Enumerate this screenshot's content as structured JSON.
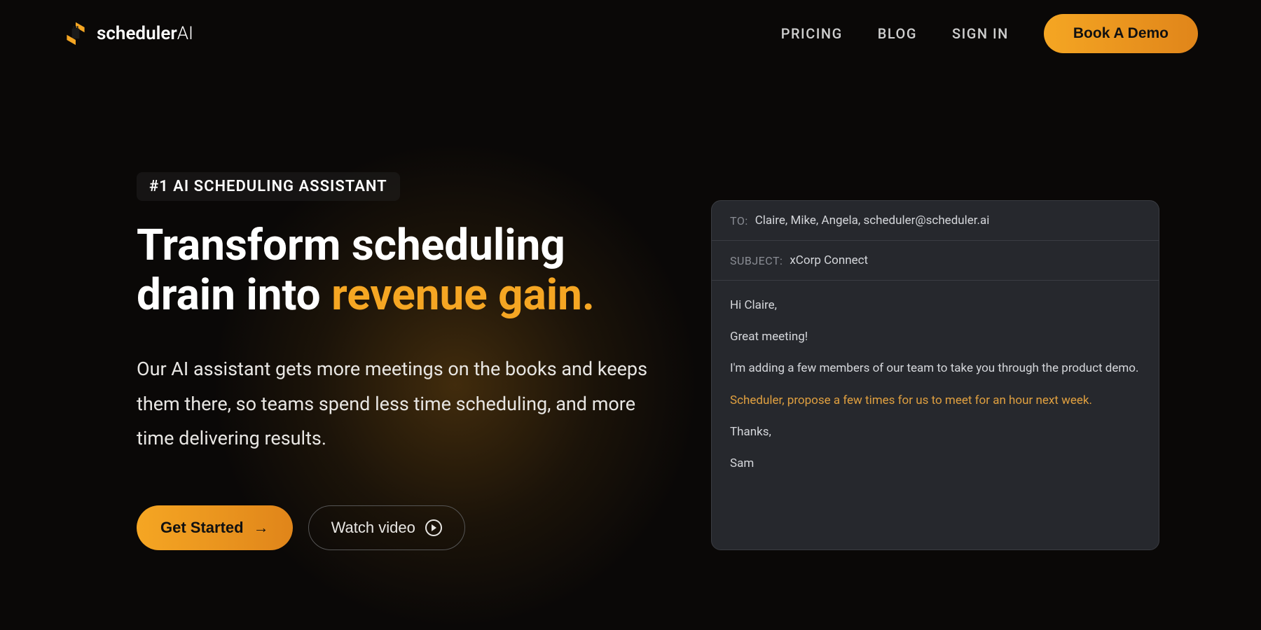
{
  "brand": {
    "name_main": "scheduler",
    "name_suffix": "AI"
  },
  "nav": {
    "pricing": "PRICING",
    "blog": "BLOG",
    "signin": "SIGN IN",
    "demo_btn": "Book A Demo"
  },
  "hero": {
    "badge": "#1 AI SCHEDULING ASSISTANT",
    "headline_part1": "Transform scheduling drain into ",
    "headline_accent": "revenue gain.",
    "subtitle": "Our AI assistant gets more meetings on the books and keeps them there, so teams spend less time scheduling, and more time delivering results.",
    "cta_primary": "Get Started",
    "cta_secondary": "Watch video"
  },
  "email": {
    "to_label": "TO:",
    "to_value": "Claire, Mike, Angela, scheduler@scheduler.ai",
    "subject_label": "SUBJECT:",
    "subject_value": "xCorp Connect",
    "body": {
      "line1": "Hi Claire,",
      "line2": "Great meeting!",
      "line3": "I'm adding a few members of our team to take you through the product demo.",
      "highlight": "Scheduler, propose a few times for us to meet for an hour next week.",
      "line4": "Thanks,",
      "line5": "Sam"
    }
  }
}
